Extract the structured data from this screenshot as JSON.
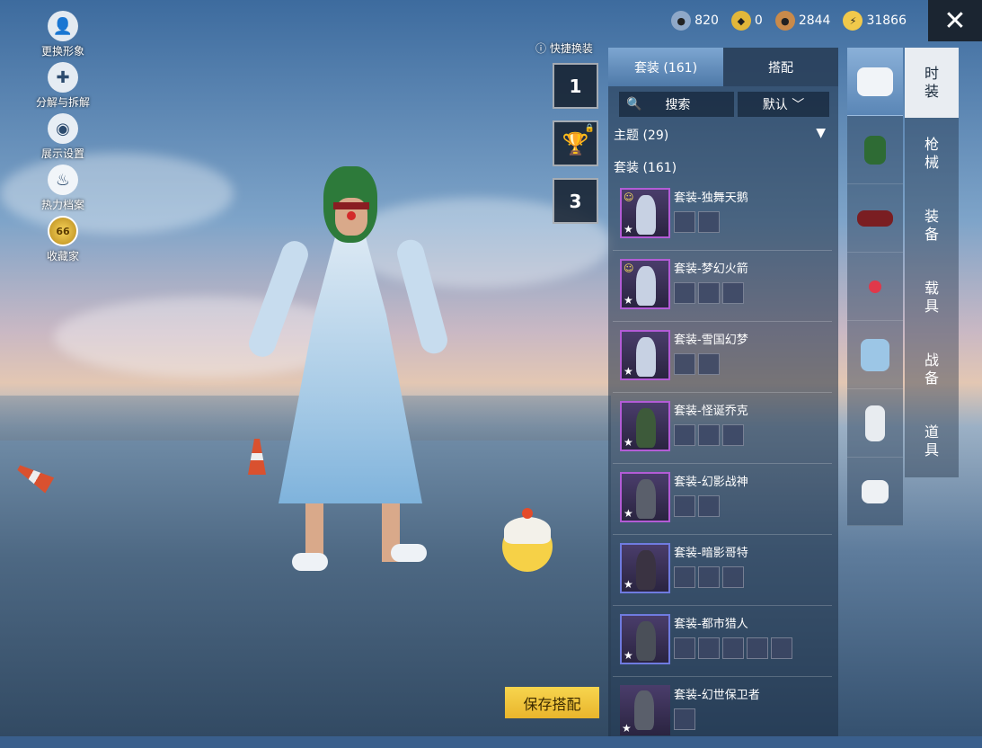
{
  "left_menu": [
    {
      "label": "更换形象",
      "icon": "person-icon"
    },
    {
      "label": "分解与拆解",
      "icon": "puzzle-icon"
    },
    {
      "label": "展示设置",
      "icon": "eye-icon"
    },
    {
      "label": "热力档案",
      "icon": "flame-icon"
    },
    {
      "label": "收藏家",
      "icon": "collector-badge-icon",
      "badge": "66"
    }
  ],
  "quick_switch": {
    "label": "快捷换装",
    "slots": [
      "1",
      "trophy",
      "3"
    ]
  },
  "currencies": [
    {
      "icon": "silver-coin-icon",
      "value": "820",
      "color": "#8fa8c8"
    },
    {
      "icon": "gold-token-icon",
      "value": "0",
      "color": "#e2b73a"
    },
    {
      "icon": "bronze-coin-icon",
      "value": "2844",
      "color": "#c98a4a"
    },
    {
      "icon": "lightning-coin-icon",
      "value": "31866",
      "color": "#f1c94b"
    }
  ],
  "close_label": "✕",
  "panel": {
    "tabs": [
      "套装 (161)",
      "搭配"
    ],
    "search_label": "搜索",
    "sort_label": "默认",
    "theme_label": "主题 (29)",
    "section_label": "套装 (161)",
    "items": [
      {
        "title": "套装-独舞天鹅",
        "subs": 2,
        "emote": true
      },
      {
        "title": "套装-梦幻火箭",
        "subs": 3,
        "emote": true
      },
      {
        "title": "套装-雪国幻梦",
        "subs": 2,
        "emote": false
      },
      {
        "title": "套装-怪诞乔克",
        "subs": 3,
        "emote": false
      },
      {
        "title": "套装-幻影战神",
        "subs": 2,
        "emote": false
      },
      {
        "title": "套装-暗影哥特",
        "subs": 3,
        "emote": false
      },
      {
        "title": "套装-都市猎人",
        "subs": 5,
        "emote": false
      },
      {
        "title": "套装-幻世保卫者",
        "subs": 1,
        "emote": false
      }
    ]
  },
  "vertical_tabs": [
    "outfit-box-icon",
    "glove-icon",
    "hat-icon",
    "pin-icon",
    "jacket-icon",
    "pants-icon",
    "shoes-icon"
  ],
  "categories": [
    "时\n装",
    "枪\n械",
    "装\n备",
    "载\n具",
    "战\n备",
    "道\n具"
  ],
  "save_button": "保存搭配"
}
